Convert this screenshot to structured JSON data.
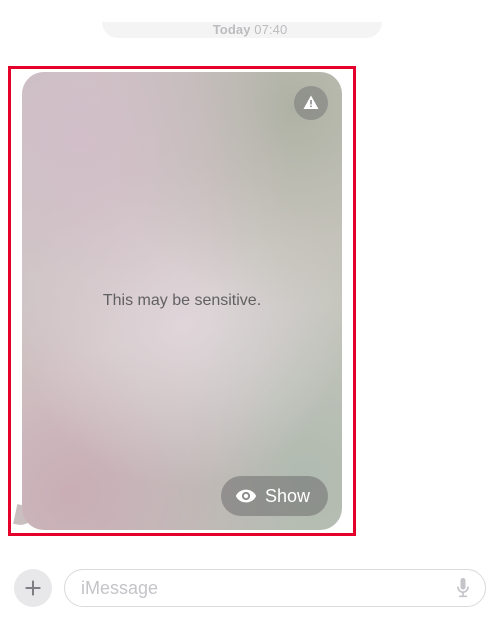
{
  "timestamp": {
    "day": "Today",
    "time": "07:40"
  },
  "message": {
    "sensitive_label": "This may be sensitive.",
    "show_button_label": "Show"
  },
  "composer": {
    "placeholder": "iMessage"
  },
  "colors": {
    "highlight": "#e4002b",
    "pill_bg": "rgba(110,110,110,0.55)"
  }
}
